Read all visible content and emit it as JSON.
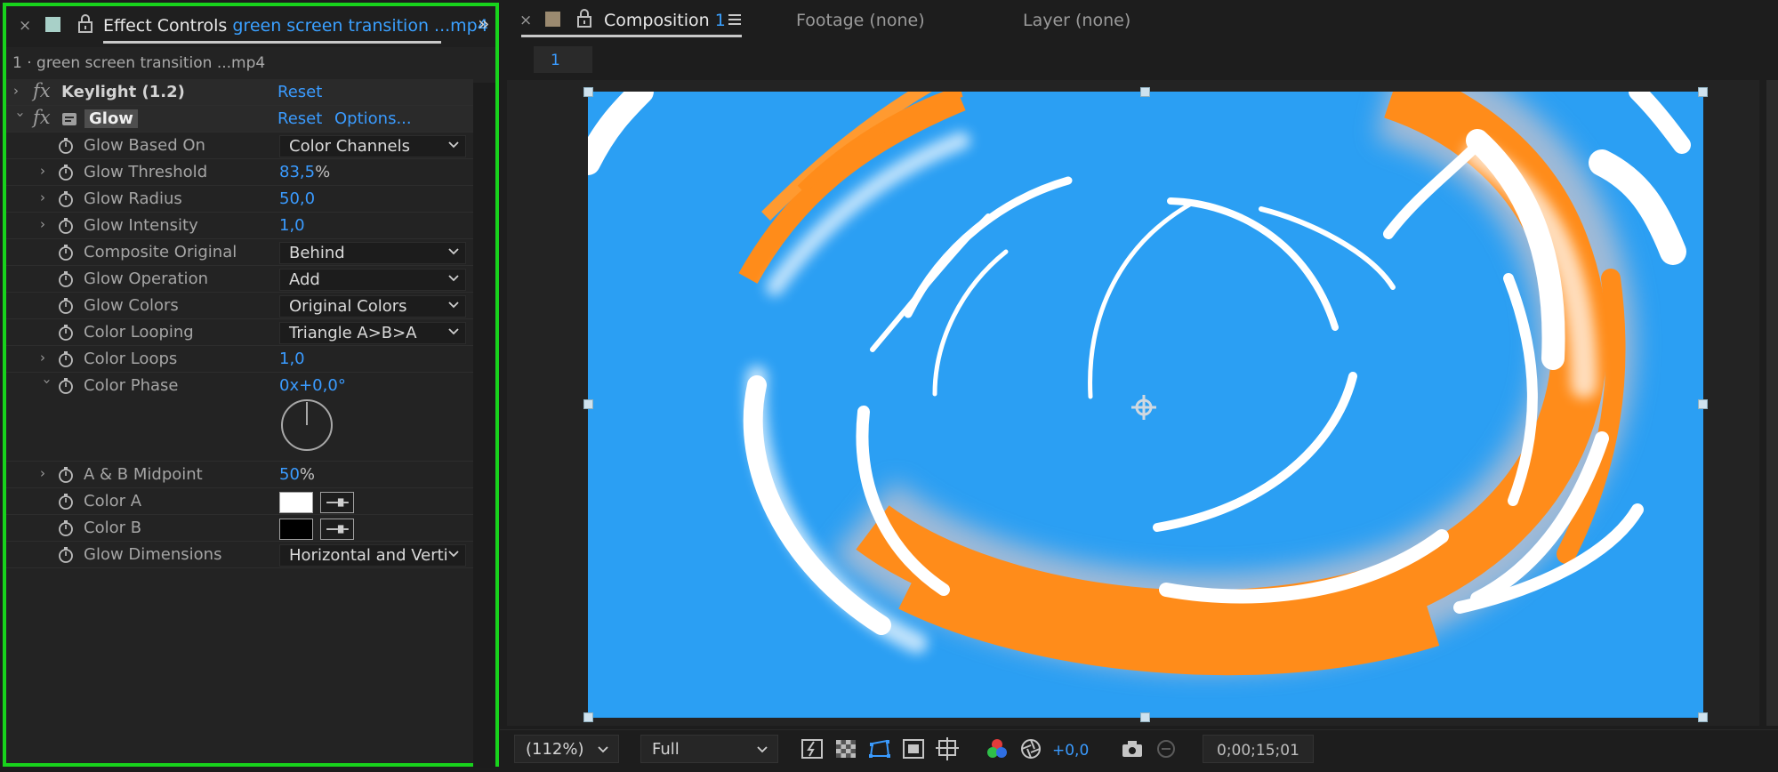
{
  "effect_controls": {
    "tab_label": "Effect Controls",
    "tab_layer": "green screen transition ...mp4",
    "layer_path": "1 · green screen transition ...mp4",
    "effects": [
      {
        "name": "Keylight (1.2)",
        "reset": "Reset"
      },
      {
        "name": "Glow",
        "reset": "Reset",
        "options": "Options..."
      }
    ],
    "params": [
      {
        "label": "Glow Based On",
        "value": "Color Channels"
      },
      {
        "label": "Glow Threshold",
        "value": "83,5",
        "unit": "%"
      },
      {
        "label": "Glow Radius",
        "value": "50,0"
      },
      {
        "label": "Glow Intensity",
        "value": "1,0"
      },
      {
        "label": "Composite Original",
        "value": "Behind"
      },
      {
        "label": "Glow Operation",
        "value": "Add"
      },
      {
        "label": "Glow Colors",
        "value": "Original Colors"
      },
      {
        "label": "Color Looping",
        "value": "Triangle A>B>A"
      },
      {
        "label": "Color Loops",
        "value": "1,0"
      },
      {
        "label": "Color Phase",
        "value": "0x+0,0°"
      },
      {
        "label": "A & B Midpoint",
        "value": "50",
        "unit": "%"
      },
      {
        "label": "Color A",
        "color": "#ffffff"
      },
      {
        "label": "Color B",
        "color": "#000000"
      },
      {
        "label": "Glow Dimensions",
        "value": "Horizontal and Verti"
      }
    ]
  },
  "composition": {
    "tab_label": "Composition",
    "tab_name": "1",
    "footage_tab": "Footage (none)",
    "layer_tab": "Layer (none)",
    "comp_subtab": "1",
    "bg_color": "#2b9ff3"
  },
  "viewer_toolbar": {
    "zoom": "(112%)",
    "resolution": "Full",
    "exposure": "+0,0",
    "timecode": "0;00;15;01"
  },
  "colors": {
    "selection_border": "#18d31c",
    "link_blue": "#3a9bff"
  }
}
